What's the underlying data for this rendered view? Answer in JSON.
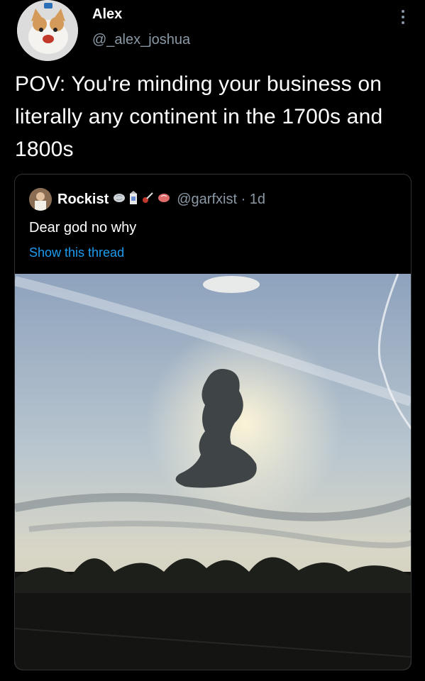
{
  "author": {
    "name": "Alex",
    "handle": "@_alex_joshua"
  },
  "tweet": {
    "text": "POV: You're minding your business on literally any continent in the 1700s and 1800s"
  },
  "quoted": {
    "name": "Rockist",
    "handle": "@garfxist · 1d",
    "text": "Dear god no why",
    "show_thread": "Show this thread",
    "emojis": [
      "brain-icon",
      "milk-carton-icon",
      "guitar-icon",
      "brain-icon"
    ]
  },
  "colors": {
    "background": "#000000",
    "secondary_text": "#8b98a5",
    "link": "#1d9bf0",
    "card_border": "#2f3336"
  }
}
